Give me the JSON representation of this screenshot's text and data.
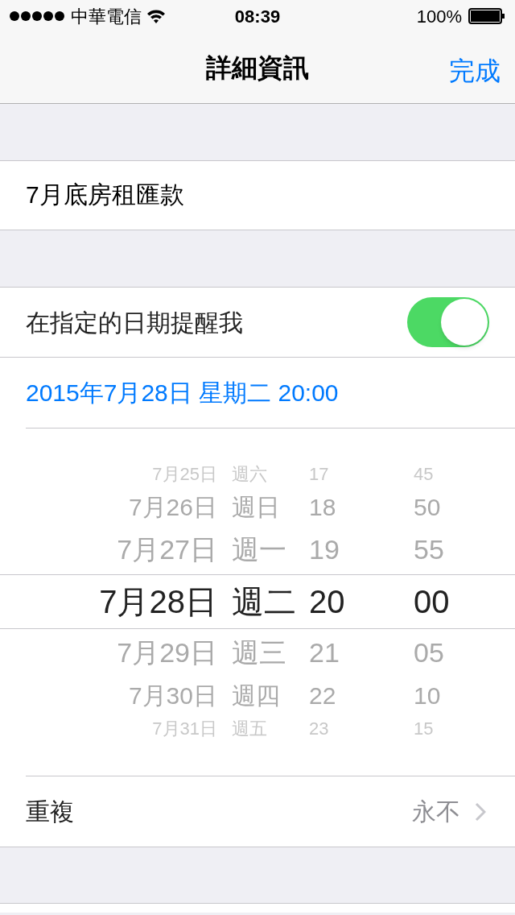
{
  "status_bar": {
    "carrier": "中華電信",
    "time": "08:39",
    "battery": "100%"
  },
  "nav": {
    "title": "詳細資訊",
    "done": "完成"
  },
  "title_field": {
    "value": "7月底房租匯款"
  },
  "reminder": {
    "label": "在指定的日期提醒我",
    "on": true
  },
  "date_text": "2015年7月28日 星期二 20:00",
  "picker": {
    "rows": [
      {
        "date": "7月25日",
        "weekday": "週六",
        "hour": "17",
        "minute": "45",
        "selected": false
      },
      {
        "date": "7月26日",
        "weekday": "週日",
        "hour": "18",
        "minute": "50",
        "selected": false
      },
      {
        "date": "7月27日",
        "weekday": "週一",
        "hour": "19",
        "minute": "55",
        "selected": false
      },
      {
        "date": "7月28日",
        "weekday": "週二",
        "hour": "20",
        "minute": "00",
        "selected": true
      },
      {
        "date": "7月29日",
        "weekday": "週三",
        "hour": "21",
        "minute": "05",
        "selected": false
      },
      {
        "date": "7月30日",
        "weekday": "週四",
        "hour": "22",
        "minute": "10",
        "selected": false
      },
      {
        "date": "7月31日",
        "weekday": "週五",
        "hour": "23",
        "minute": "15",
        "selected": false
      }
    ]
  },
  "repeat": {
    "label": "重複",
    "value": "永不"
  }
}
